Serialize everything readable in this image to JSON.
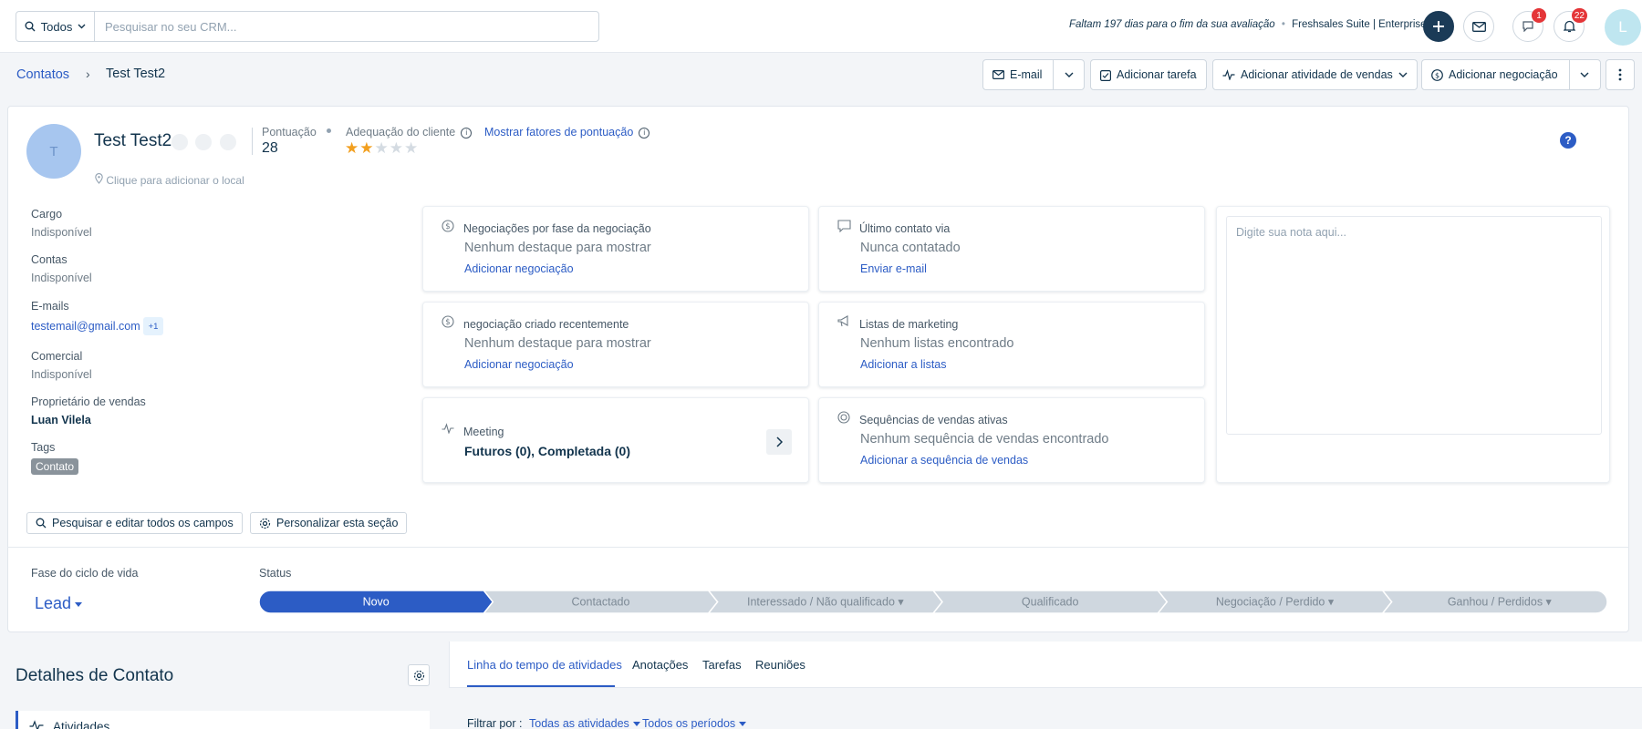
{
  "topbar": {
    "search_scope": "Todos",
    "search_placeholder": "Pesquisar no seu CRM...",
    "trial_text": "Faltam 197 dias para o fim da sua avaliação",
    "suite_text": "Freshsales Suite | ",
    "plan": "Enterprise",
    "notif_badge_1": "1",
    "notif_badge_2": "22",
    "user_initial": "L"
  },
  "breadcrumb": {
    "parent": "Contatos",
    "current": "Test Test2"
  },
  "toolbar": {
    "email": "E-mail",
    "add_task": "Adicionar tarefa",
    "add_sales_activity": "Adicionar atividade de vendas",
    "add_deal": "Adicionar negociação"
  },
  "contact": {
    "initial": "T",
    "name": "Test Test2",
    "score_label": "Pontuação",
    "score": "28",
    "fit_label": "Adequação do cliente",
    "fit_rating": 2,
    "fit_max": 5,
    "show_factors": "Mostrar fatores de pontuação",
    "location_placeholder": "Clique para adicionar o local"
  },
  "fields": {
    "job_label": "Cargo",
    "job_value": "Indisponível",
    "accounts_label": "Contas",
    "accounts_value": "Indisponível",
    "emails_label": "E-mails",
    "email_value": "testemail@gmail.com",
    "email_more": "+1",
    "sales_label": "Comercial",
    "sales_value": "Indisponível",
    "owner_label": "Proprietário de vendas",
    "owner_value": "Luan Vilela",
    "tags_label": "Tags",
    "tag_value": "Contato"
  },
  "widgets": {
    "deals_stage": {
      "title": "Negociações por fase da negociação",
      "subtitle": "Nenhum destaque para mostrar",
      "link": "Adicionar negociação"
    },
    "last_contact": {
      "title": "Último contato via",
      "subtitle": "Nunca contatado",
      "link": "Enviar e-mail"
    },
    "recent_deal": {
      "title": "negociação criado recentemente",
      "subtitle": "Nenhum destaque para mostrar",
      "link": "Adicionar negociação"
    },
    "marketing": {
      "title": "Listas de marketing",
      "subtitle": "Nenhum listas encontrado",
      "link": "Adicionar a listas"
    },
    "meeting": {
      "title": "Meeting",
      "subtitle": "Futuros (0), Completada (0)"
    },
    "sequences": {
      "title": "Sequências de vendas ativas",
      "subtitle": "Nenhum sequência de vendas encontrado",
      "link": "Adicionar a sequência de vendas"
    },
    "note_placeholder": "Digite sua nota aqui..."
  },
  "actions": {
    "search_edit": "Pesquisar e editar todos os campos",
    "customize": "Personalizar esta seção"
  },
  "lifecycle": {
    "label": "Fase do ciclo de vida",
    "value": "Lead",
    "status_label": "Status",
    "stages": [
      {
        "label": "Novo",
        "active": true,
        "dropdown": false
      },
      {
        "label": "Contactado",
        "active": false,
        "dropdown": false
      },
      {
        "label": "Interessado / Não qualificado",
        "active": false,
        "dropdown": true
      },
      {
        "label": "Qualificado",
        "active": false,
        "dropdown": false
      },
      {
        "label": "Negociação / Perdido",
        "active": false,
        "dropdown": true
      },
      {
        "label": "Ganhou / Perdidos",
        "active": false,
        "dropdown": true
      }
    ]
  },
  "details": {
    "title": "Detalhes de Contato",
    "activities": "Atividades"
  },
  "tabs": {
    "timeline": "Linha do tempo de atividades",
    "notes": "Anotações",
    "tasks": "Tarefas",
    "meetings": "Reuniões"
  },
  "filter": {
    "label": "Filtrar por :",
    "activities": "Todas as atividades",
    "period": "Todos os períodos"
  },
  "colors": {
    "accent": "#2c5cc5",
    "dark": "#12344d",
    "stage_active": "#2c5cc5",
    "stage_inactive": "#cfd7df",
    "star": "#f29f1e",
    "badge": "#e43538"
  }
}
